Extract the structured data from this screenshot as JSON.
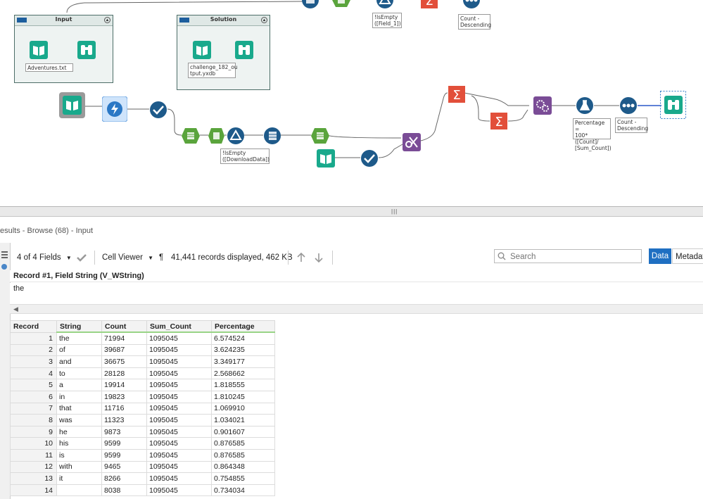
{
  "containers": {
    "input": {
      "title": "Input",
      "file_label": "Adventures.txt"
    },
    "solution": {
      "title": "Solution",
      "file_label": "challenge_182_ou\ntput.yxdb"
    }
  },
  "annotations": {
    "top_filter": "!IsEmpty\n([Field_1])",
    "top_sort": "Count -\nDescending",
    "filter": "!IsEmpty\n([DownloadData])",
    "formula": "Percentage =\n100*([Count]/\n[Sum_Count])",
    "sort": "Count -\nDescending"
  },
  "splitter": {
    "grip": "|||"
  },
  "results": {
    "title": "esults - Browse (68) - Input",
    "fields_label": "4 of 4 Fields",
    "viewer_label": "Cell Viewer",
    "pilcrow": "¶",
    "records_label": "41,441 records displayed, 462 KB",
    "search_placeholder": "Search",
    "data_tab": "Data",
    "metadata_tab": "Metadata",
    "cell_header": "Record #1, Field String (V_WString)",
    "cell_value": "the"
  },
  "table": {
    "columns": [
      "Record",
      "String",
      "Count",
      "Sum_Count",
      "Percentage"
    ],
    "rows": [
      [
        "1",
        "the",
        "71994",
        "1095045",
        "6.574524"
      ],
      [
        "2",
        "of",
        "39687",
        "1095045",
        "3.624235"
      ],
      [
        "3",
        "and",
        "36675",
        "1095045",
        "3.349177"
      ],
      [
        "4",
        "to",
        "28128",
        "1095045",
        "2.568662"
      ],
      [
        "5",
        "a",
        "19914",
        "1095045",
        "1.818555"
      ],
      [
        "6",
        "in",
        "19823",
        "1095045",
        "1.810245"
      ],
      [
        "7",
        "that",
        "11716",
        "1095045",
        "1.069910"
      ],
      [
        "8",
        "was",
        "11323",
        "1095045",
        "1.034021"
      ],
      [
        "9",
        "he",
        "9873",
        "1095045",
        "0.901607"
      ],
      [
        "10",
        "his",
        "9599",
        "1095045",
        "0.876585"
      ],
      [
        "11",
        "is",
        "9599",
        "1095045",
        "0.876585"
      ],
      [
        "12",
        "with",
        "9465",
        "1095045",
        "0.864348"
      ],
      [
        "13",
        "it",
        "8266",
        "1095045",
        "0.754855"
      ],
      [
        "14",
        "",
        "8038",
        "1095045",
        "0.734034"
      ]
    ]
  },
  "colors": {
    "input_tool": "#19a98c",
    "browse_tool": "#19a98c",
    "parse_tool": "#1e5a8a",
    "join_tool": "#7a4c96",
    "summarize_tool": "#e24f3a",
    "formula_tool": "#1e5a8a",
    "accent": "#1f6fc2"
  }
}
